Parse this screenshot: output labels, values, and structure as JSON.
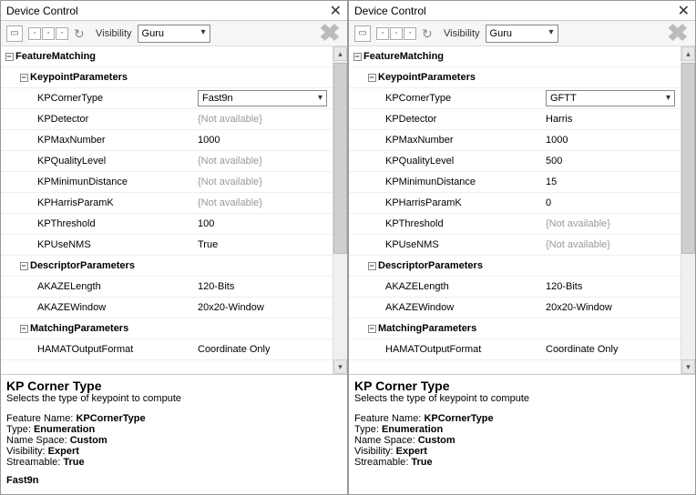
{
  "panels": [
    {
      "title": "Device Control",
      "visibility_label": "Visibility",
      "visibility_value": "Guru",
      "tree_root": "FeatureMatching",
      "groups": [
        {
          "name": "KeypointParameters",
          "items": [
            {
              "label": "KPCornerType",
              "value": "Fast9n",
              "editor": "dropdown",
              "na": false
            },
            {
              "label": "KPDetector",
              "value": "{Not available}",
              "na": true
            },
            {
              "label": "KPMaxNumber",
              "value": "1000",
              "na": false
            },
            {
              "label": "KPQualityLevel",
              "value": "{Not available}",
              "na": true
            },
            {
              "label": "KPMinimunDistance",
              "value": "{Not available}",
              "na": true
            },
            {
              "label": "KPHarrisParamK",
              "value": "{Not available}",
              "na": true
            },
            {
              "label": "KPThreshold",
              "value": "100",
              "na": false
            },
            {
              "label": "KPUseNMS",
              "value": "True",
              "na": false
            }
          ]
        },
        {
          "name": "DescriptorParameters",
          "items": [
            {
              "label": "AKAZELength",
              "value": "120-Bits",
              "na": false
            },
            {
              "label": "AKAZEWindow",
              "value": "20x20-Window",
              "na": false
            }
          ]
        },
        {
          "name": "MatchingParameters",
          "items": [
            {
              "label": "HAMATOutputFormat",
              "value": "Coordinate Only",
              "na": false
            }
          ]
        }
      ],
      "desc": {
        "title": "KP Corner Type",
        "text": "Selects the type of keypoint to compute",
        "feature_name_label": "Feature Name:",
        "feature_name": "KPCornerType",
        "type_label": "Type:",
        "type": "Enumeration",
        "ns_label": "Name Space:",
        "ns": "Custom",
        "vis_label": "Visibility:",
        "vis": "Expert",
        "stream_label": "Streamable:",
        "stream": "True",
        "value": "Fast9n"
      }
    },
    {
      "title": "Device Control",
      "visibility_label": "Visibility",
      "visibility_value": "Guru",
      "tree_root": "FeatureMatching",
      "groups": [
        {
          "name": "KeypointParameters",
          "items": [
            {
              "label": "KPCornerType",
              "value": "GFTT",
              "editor": "dropdown",
              "na": false
            },
            {
              "label": "KPDetector",
              "value": "Harris",
              "na": false
            },
            {
              "label": "KPMaxNumber",
              "value": "1000",
              "na": false
            },
            {
              "label": "KPQualityLevel",
              "value": "500",
              "na": false
            },
            {
              "label": "KPMinimunDistance",
              "value": "15",
              "na": false
            },
            {
              "label": "KPHarrisParamK",
              "value": "0",
              "na": false
            },
            {
              "label": "KPThreshold",
              "value": "{Not available}",
              "na": true
            },
            {
              "label": "KPUseNMS",
              "value": "{Not available}",
              "na": true
            }
          ]
        },
        {
          "name": "DescriptorParameters",
          "items": [
            {
              "label": "AKAZELength",
              "value": "120-Bits",
              "na": false
            },
            {
              "label": "AKAZEWindow",
              "value": "20x20-Window",
              "na": false
            }
          ]
        },
        {
          "name": "MatchingParameters",
          "items": [
            {
              "label": "HAMATOutputFormat",
              "value": "Coordinate Only",
              "na": false
            }
          ]
        }
      ],
      "desc": {
        "title": "KP Corner Type",
        "text": "Selects the type of keypoint to compute",
        "feature_name_label": "Feature Name:",
        "feature_name": "KPCornerType",
        "type_label": "Type:",
        "type": "Enumeration",
        "ns_label": "Name Space:",
        "ns": "Custom",
        "vis_label": "Visibility:",
        "vis": "Expert",
        "stream_label": "Streamable:",
        "stream": "True",
        "value": ""
      }
    }
  ]
}
